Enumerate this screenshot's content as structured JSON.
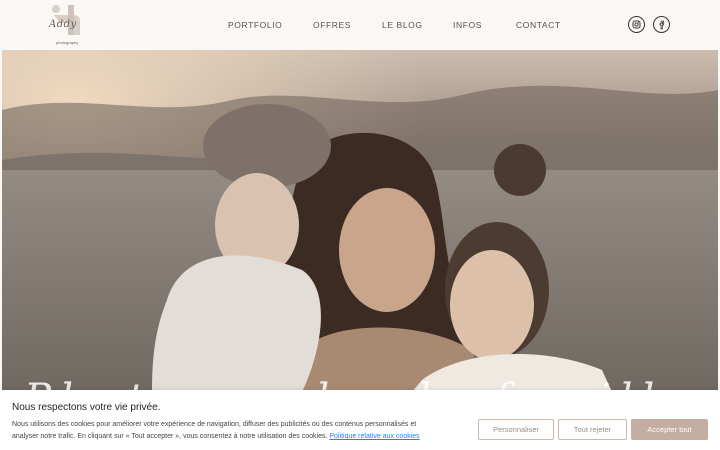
{
  "brand": {
    "logo_script": "Addy",
    "logo_sub": "photography"
  },
  "nav": {
    "items": [
      "PORTFOLIO",
      "OFFRES",
      "LE BLOG",
      "INFOS",
      "CONTACT"
    ]
  },
  "social": {
    "icons": [
      "instagram-icon",
      "facebook-icon"
    ]
  },
  "hero": {
    "title": "Photographe de famille"
  },
  "cookie": {
    "title": "Nous respectons votre vie privée.",
    "text_line1": "Nous utilisons des cookies pour améliorer votre expérience de navigation, diffuser des publicités ou des contenus personnalisés et",
    "text_line2": "analyser notre trafic. En cliquant sur « Tout accepter », vous consentez à notre utilisation des cookies. ",
    "link": "Politique relative aux cookies",
    "btn_customize": "Personnaliser",
    "btn_reject": "Tout rejeter",
    "btn_accept": "Accepter tout"
  },
  "colors": {
    "accent": "#c4ada1",
    "background": "#faf8f5",
    "link": "#3478f6"
  }
}
